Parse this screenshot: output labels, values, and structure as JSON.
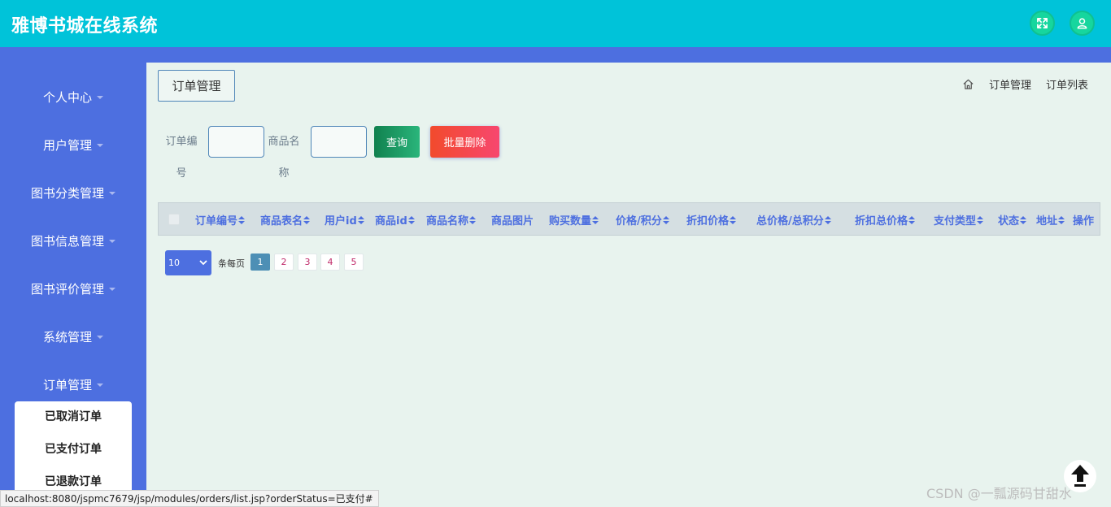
{
  "header": {
    "title": "雅博书城在线系统"
  },
  "sidebar": {
    "items": [
      {
        "label": "个人中心"
      },
      {
        "label": "用户管理"
      },
      {
        "label": "图书分类管理"
      },
      {
        "label": "图书信息管理"
      },
      {
        "label": "图书评价管理"
      },
      {
        "label": "系统管理"
      },
      {
        "label": "订单管理"
      }
    ],
    "submenu": [
      {
        "label": "已取消订单"
      },
      {
        "label": "已支付订单"
      },
      {
        "label": "已退款订单"
      }
    ]
  },
  "main": {
    "page_tag": "订单管理",
    "breadcrumb": [
      "订单管理",
      "订单列表"
    ],
    "filters": {
      "order_no_label": "订单编号",
      "order_no_value": "",
      "product_name_label": "商品名称",
      "product_name_value": ""
    },
    "buttons": {
      "query": "查询",
      "batch_delete": "批量删除"
    },
    "table": {
      "headers": [
        "订单编号",
        "商品表名",
        "用户id",
        "商品id",
        "商品名称",
        "商品图片",
        "购买数量",
        "价格/积分",
        "折扣价格",
        "总价格/总积分",
        "折扣总价格",
        "支付类型",
        "状态",
        "地址",
        "操作"
      ],
      "rows": []
    },
    "pagination": {
      "page_size": "10",
      "per_page_label": "条每页",
      "pages": [
        "1",
        "2",
        "3",
        "4",
        "5"
      ],
      "current_page": "1"
    }
  },
  "status_bar": {
    "url": "localhost:8080/jspmc7679/jsp/modules/orders/list.jsp?orderStatus=已支付#"
  },
  "watermark": "CSDN @一瓢源码甘甜水",
  "colors": {
    "header": "#00c3d9",
    "sidebar": "#4d6fe0",
    "background": "#e8f3ee",
    "query_button": "#11814f",
    "delete_button": "#f24a2c"
  }
}
